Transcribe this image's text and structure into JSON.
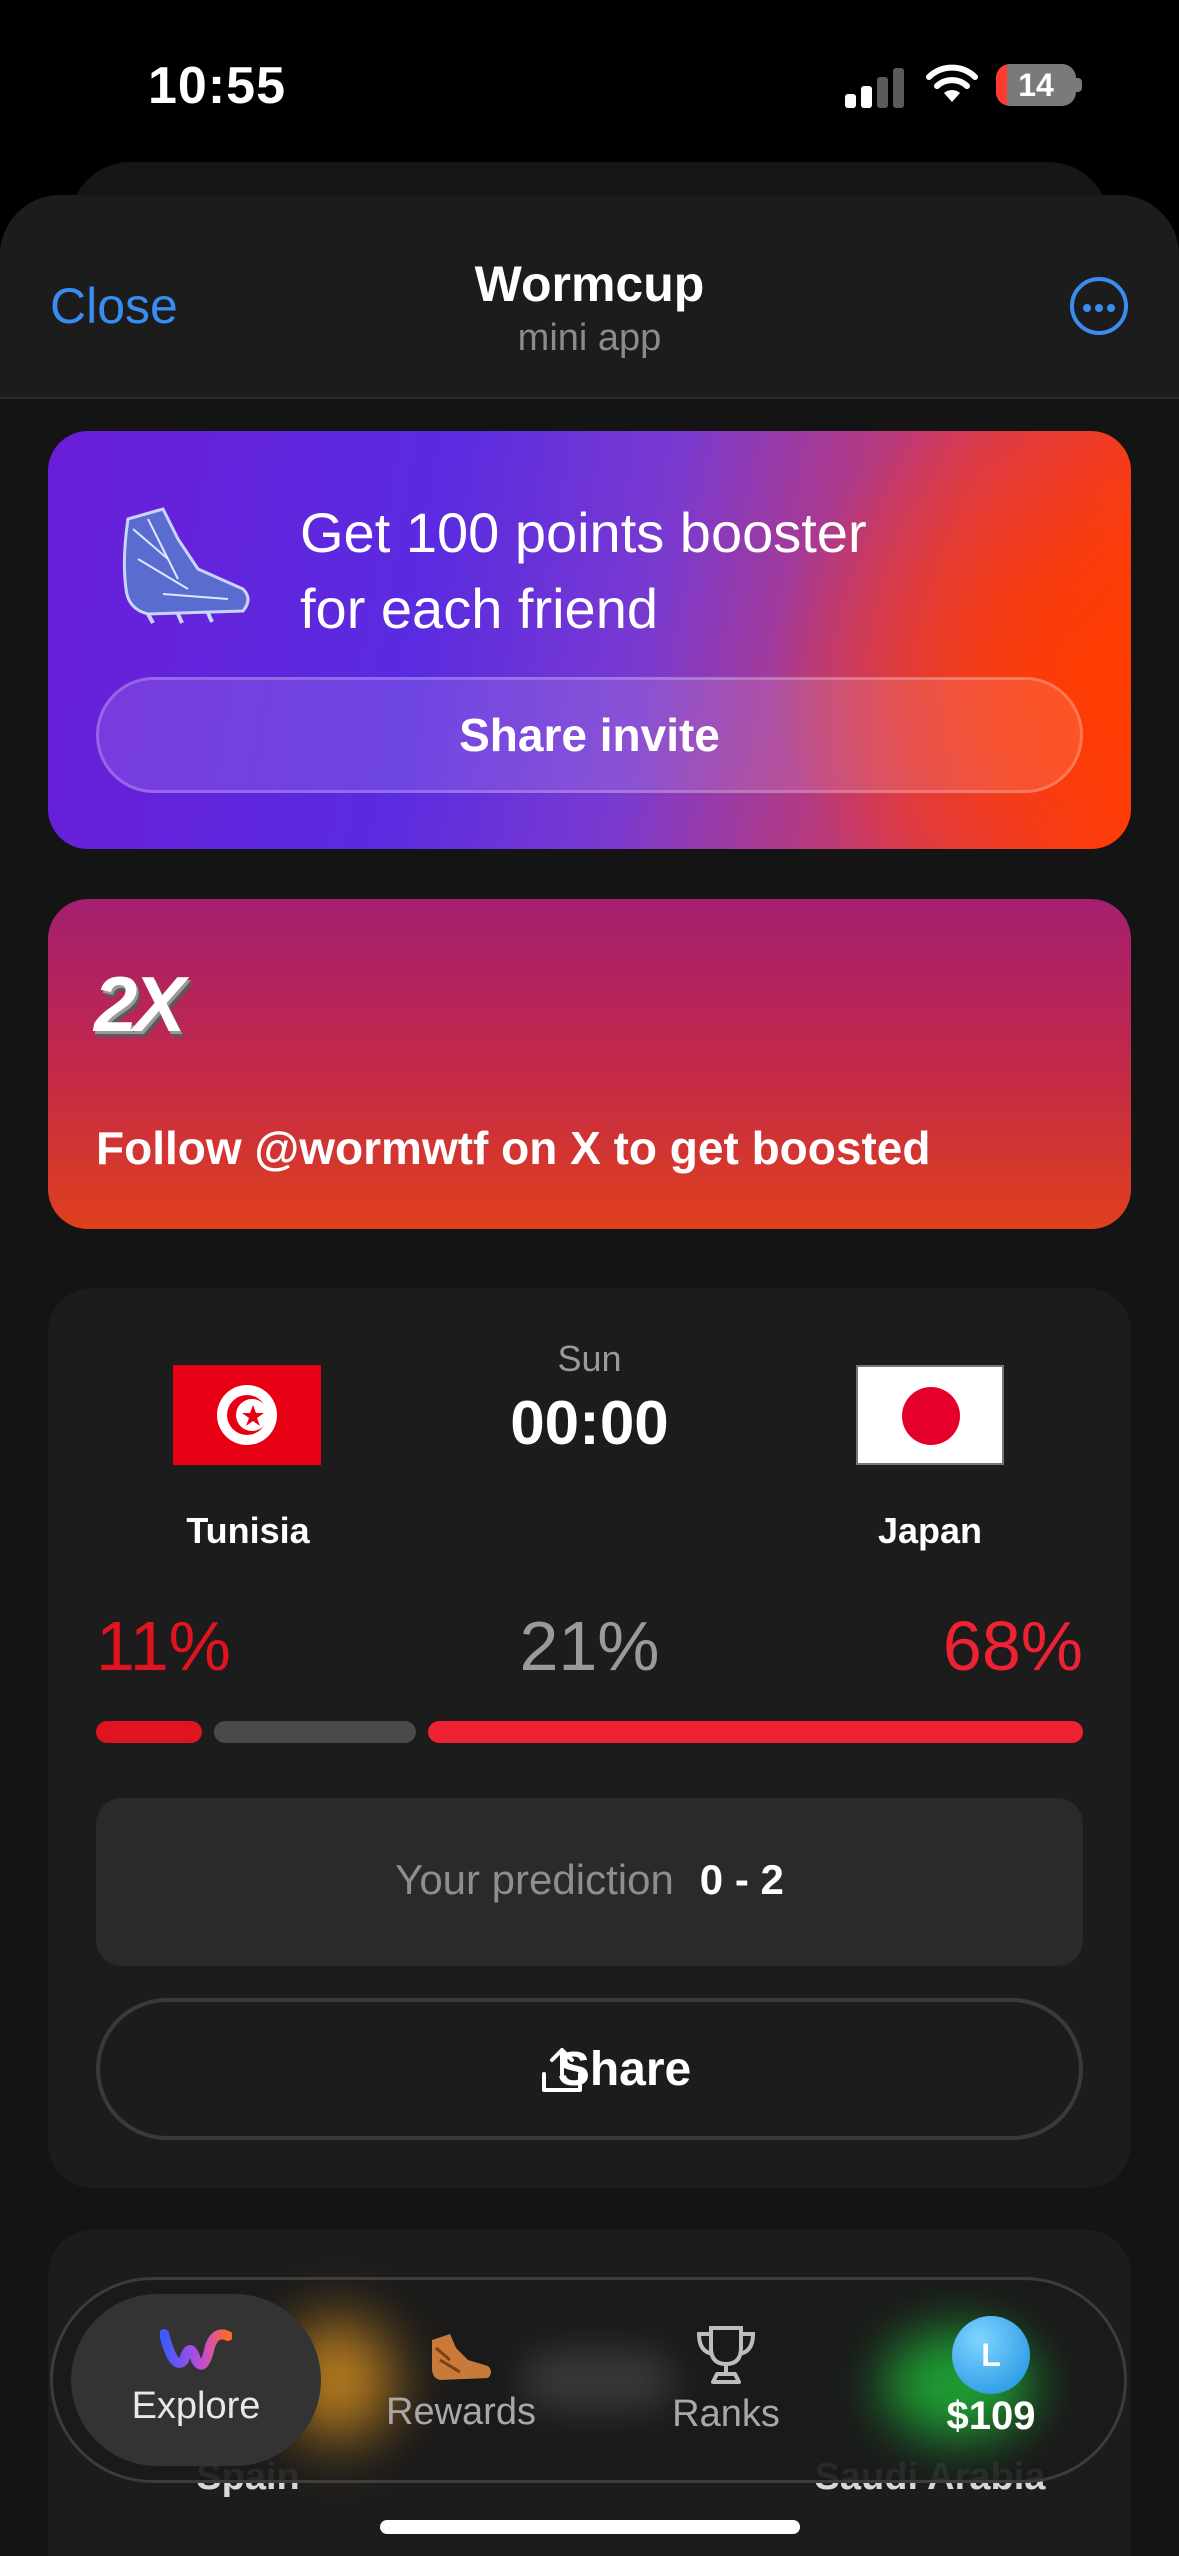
{
  "status_bar": {
    "time": "10:55",
    "battery_level": "14"
  },
  "header": {
    "close_label": "Close",
    "title": "Wormcup",
    "subtitle": "mini app"
  },
  "invite_card": {
    "title_line1": "Get 100 points booster",
    "title_line2": "for each friend",
    "button_label": "Share invite"
  },
  "boost_card": {
    "multiplier": "2X",
    "text": "Follow @wormwtf on X to get boosted"
  },
  "match": {
    "home_team": "Tunisia",
    "away_team": "Japan",
    "day": "Sun",
    "kickoff": "00:00",
    "home_pct_label": "11%",
    "draw_pct_label": "21%",
    "away_pct_label": "68%",
    "home_pct": 11,
    "draw_pct": 21,
    "away_pct": 68,
    "prediction_label": "Your prediction",
    "prediction_value": "0 - 2",
    "share_label": "Share"
  },
  "next_match": {
    "home_team": "Spain",
    "away_team": "Saudi Arabia"
  },
  "tabbar": {
    "tabs": [
      {
        "label": "Explore",
        "icon": "worm-logo-icon",
        "selected": true
      },
      {
        "label": "Rewards",
        "icon": "boot-icon",
        "selected": false
      },
      {
        "label": "Ranks",
        "icon": "trophy-icon",
        "selected": false
      },
      {
        "label": "$109",
        "icon": "avatar",
        "selected": false
      }
    ],
    "avatar_letter": "L"
  },
  "colors": {
    "accent_blue": "#3a8df0",
    "home_red": "#e0141e",
    "away_red": "#ee2233",
    "draw_gray": "#4a4a4a"
  }
}
